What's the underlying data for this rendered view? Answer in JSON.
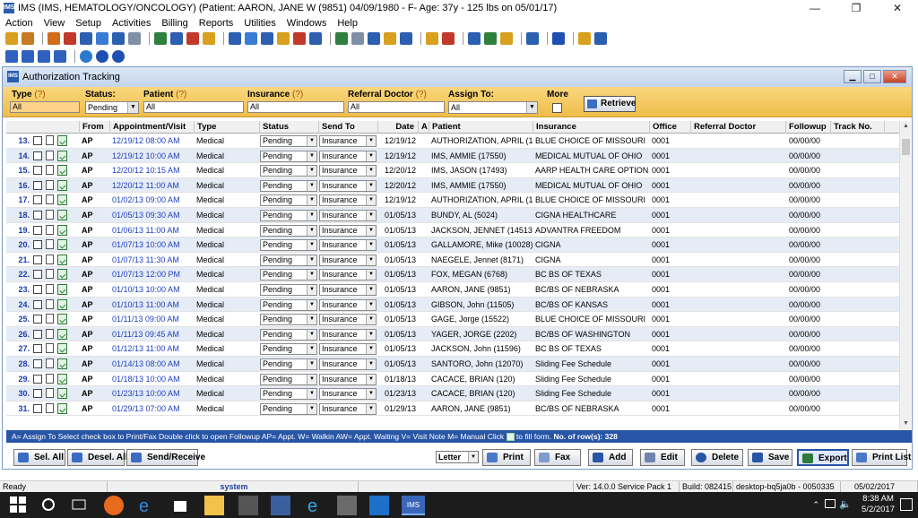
{
  "window": {
    "title": "IMS (IMS, HEMATOLOGY/ONCOLOGY)     (Patient: AARON, JANE W (9851) 04/09/1980 - F- Age: 37y  - 125 lbs on 05/01/17)",
    "app_icon": "IMS",
    "minimize": "—",
    "restore": "❐",
    "close": "✕"
  },
  "menu": [
    "Action",
    "View",
    "Setup",
    "Activities",
    "Billing",
    "Reports",
    "Utilities",
    "Windows",
    "Help"
  ],
  "child": {
    "title": "Authorization Tracking",
    "filters": {
      "type_label": "Type",
      "type_value": "All",
      "status_label": "Status:",
      "status_value": "Pending",
      "patient_label": "Patient",
      "patient_value": "All",
      "insurance_label": "Insurance",
      "insurance_value": "All",
      "refdoc_label": "Referral Doctor",
      "refdoc_value": "All",
      "assign_label": "Assign To:",
      "assign_value": "All",
      "more_label": "More",
      "help_mark": "(?)",
      "retrieve": "Retrieve"
    },
    "columns": [
      "From",
      "Appointment/Visit",
      "Type",
      "Status",
      "Send To",
      "Date",
      "A",
      "Patient",
      "Insurance",
      "Office",
      "Referral Doctor",
      "Followup",
      "Track No."
    ],
    "rows": [
      {
        "n": "13.",
        "from": "AP",
        "appt": "12/19/12 08:00 AM",
        "type": "Medical",
        "status": "Pending",
        "send": "Insurance",
        "date": "12/19/12",
        "patient": "AUTHORIZATION, APRIL  (1757",
        "ins": "BLUE CHOICE OF MISSOURI",
        "office": "0001",
        "followup": "00/00/00"
      },
      {
        "n": "14.",
        "from": "AP",
        "appt": "12/19/12 10:00 AM",
        "type": "Medical",
        "status": "Pending",
        "send": "Insurance",
        "date": "12/19/12",
        "patient": "IMS, AMMIE  (17550)",
        "ins": "MEDICAL MUTUAL OF OHIO",
        "office": "0001",
        "followup": "00/00/00"
      },
      {
        "n": "15.",
        "from": "AP",
        "appt": "12/20/12 10:15 AM",
        "type": "Medical",
        "status": "Pending",
        "send": "Insurance",
        "date": "12/20/12",
        "patient": "IMS, JASON  (17493)",
        "ins": "AARP HEALTH CARE OPTIONS",
        "office": "0001",
        "followup": "00/00/00"
      },
      {
        "n": "16.",
        "from": "AP",
        "appt": "12/20/12 11:00 AM",
        "type": "Medical",
        "status": "Pending",
        "send": "Insurance",
        "date": "12/20/12",
        "patient": "IMS, AMMIE  (17550)",
        "ins": "MEDICAL MUTUAL OF OHIO",
        "office": "0001",
        "followup": "00/00/00"
      },
      {
        "n": "17.",
        "from": "AP",
        "appt": "01/02/13 09:00 AM",
        "type": "Medical",
        "status": "Pending",
        "send": "Insurance",
        "date": "12/19/12",
        "patient": "AUTHORIZATION, APRIL  (1757",
        "ins": "BLUE CHOICE OF MISSOURI",
        "office": "0001",
        "followup": "00/00/00"
      },
      {
        "n": "18.",
        "from": "AP",
        "appt": "01/05/13 09:30 AM",
        "type": "Medical",
        "status": "Pending",
        "send": "Insurance",
        "date": "01/05/13",
        "patient": "BUNDY, AL  (5024)",
        "ins": "CIGNA HEALTHCARE",
        "office": "0001",
        "followup": "00/00/00"
      },
      {
        "n": "19.",
        "from": "AP",
        "appt": "01/06/13 11:00 AM",
        "type": "Medical",
        "status": "Pending",
        "send": "Insurance",
        "date": "01/05/13",
        "patient": "JACKSON, JENNET  (14513)",
        "ins": "ADVANTRA FREEDOM",
        "office": "0001",
        "followup": "00/00/00"
      },
      {
        "n": "20.",
        "from": "AP",
        "appt": "01/07/13 10:00 AM",
        "type": "Medical",
        "status": "Pending",
        "send": "Insurance",
        "date": "01/05/13",
        "patient": "GALLAMORE, Mike  (10028)",
        "ins": "CIGNA",
        "office": "0001",
        "followup": "00/00/00"
      },
      {
        "n": "21.",
        "from": "AP",
        "appt": "01/07/13 11:30 AM",
        "type": "Medical",
        "status": "Pending",
        "send": "Insurance",
        "date": "01/05/13",
        "patient": "NAEGELE, Jennet  (8171)",
        "ins": "CIGNA",
        "office": "0001",
        "followup": "00/00/00"
      },
      {
        "n": "22.",
        "from": "AP",
        "appt": "01/07/13 12:00 PM",
        "type": "Medical",
        "status": "Pending",
        "send": "Insurance",
        "date": "01/05/13",
        "patient": "FOX, MEGAN  (6768)",
        "ins": "BC BS OF TEXAS",
        "office": "0001",
        "followup": "00/00/00"
      },
      {
        "n": "23.",
        "from": "AP",
        "appt": "01/10/13 10:00 AM",
        "type": "Medical",
        "status": "Pending",
        "send": "Insurance",
        "date": "01/05/13",
        "patient": "AARON, JANE  (9851)",
        "ins": "BC/BS OF NEBRASKA",
        "office": "0001",
        "followup": "00/00/00"
      },
      {
        "n": "24.",
        "from": "AP",
        "appt": "01/10/13 11:00 AM",
        "type": "Medical",
        "status": "Pending",
        "send": "Insurance",
        "date": "01/05/13",
        "patient": "GIBSON, John  (11505)",
        "ins": "BC/BS OF KANSAS",
        "office": "0001",
        "followup": "00/00/00"
      },
      {
        "n": "25.",
        "from": "AP",
        "appt": "01/11/13 09:00 AM",
        "type": "Medical",
        "status": "Pending",
        "send": "Insurance",
        "date": "01/05/13",
        "patient": "GAGE, Jorge  (15522)",
        "ins": "BLUE CHOICE OF MISSOURI",
        "office": "0001",
        "followup": "00/00/00"
      },
      {
        "n": "26.",
        "from": "AP",
        "appt": "01/11/13 09:45 AM",
        "type": "Medical",
        "status": "Pending",
        "send": "Insurance",
        "date": "01/05/13",
        "patient": "YAGER, JORGE  (2202)",
        "ins": "BC/BS OF WASHINGTON",
        "office": "0001",
        "followup": "00/00/00"
      },
      {
        "n": "27.",
        "from": "AP",
        "appt": "01/12/13 11:00 AM",
        "type": "Medical",
        "status": "Pending",
        "send": "Insurance",
        "date": "01/05/13",
        "patient": "JACKSON, John  (11596)",
        "ins": "BC BS OF TEXAS",
        "office": "0001",
        "followup": "00/00/00"
      },
      {
        "n": "28.",
        "from": "AP",
        "appt": "01/14/13 08:00 AM",
        "type": "Medical",
        "status": "Pending",
        "send": "Insurance",
        "date": "01/05/13",
        "patient": "SANTORO, John  (12070)",
        "ins": "Sliding Fee Schedule",
        "office": "0001",
        "followup": "00/00/00"
      },
      {
        "n": "29.",
        "from": "AP",
        "appt": "01/18/13 10:00 AM",
        "type": "Medical",
        "status": "Pending",
        "send": "Insurance",
        "date": "01/18/13",
        "patient": "CACACE, BRIAN  (120)",
        "ins": "Sliding Fee Schedule",
        "office": "0001",
        "followup": "00/00/00"
      },
      {
        "n": "30.",
        "from": "AP",
        "appt": "01/23/13 10:00 AM",
        "type": "Medical",
        "status": "Pending",
        "send": "Insurance",
        "date": "01/23/13",
        "patient": "CACACE, BRIAN  (120)",
        "ins": "Sliding Fee Schedule",
        "office": "0001",
        "followup": "00/00/00"
      },
      {
        "n": "31.",
        "from": "AP",
        "appt": "01/29/13 07:00 AM",
        "type": "Medical",
        "status": "Pending",
        "send": "Insurance",
        "date": "01/29/13",
        "patient": "AARON, JANE  (9851)",
        "ins": "BC/BS OF NEBRASKA",
        "office": "0001",
        "followup": "00/00/00"
      }
    ],
    "legend": "A= Assign To   Select check box to Print/Fax   Double click to open Followup   AP= Appt. W= Walkin  AW= Appt. Waiting  V= Visit Note  M= Manual   Click",
    "legend_click": "to fill form.",
    "rowcount": "No. of row(s): 328",
    "buttons": {
      "sel_all": "Sel. All",
      "desel_all": "Desel. All",
      "send_receive": "Send/Receive",
      "letter": "Letter",
      "print": "Print",
      "fax": "Fax",
      "add": "Add",
      "edit": "Edit",
      "delete": "Delete",
      "save": "Save",
      "export": "Export",
      "print_list": "Print List"
    }
  },
  "status": {
    "ready": "Ready",
    "user": "system",
    "version": "Ver: 14.0.0 Service Pack 1",
    "build": "Build: 082415",
    "machine": "desktop-bq5ja0b - 0050335",
    "date": "05/02/2017"
  },
  "taskbar": {
    "time": "8:38 AM",
    "date": "5/2/2017"
  }
}
